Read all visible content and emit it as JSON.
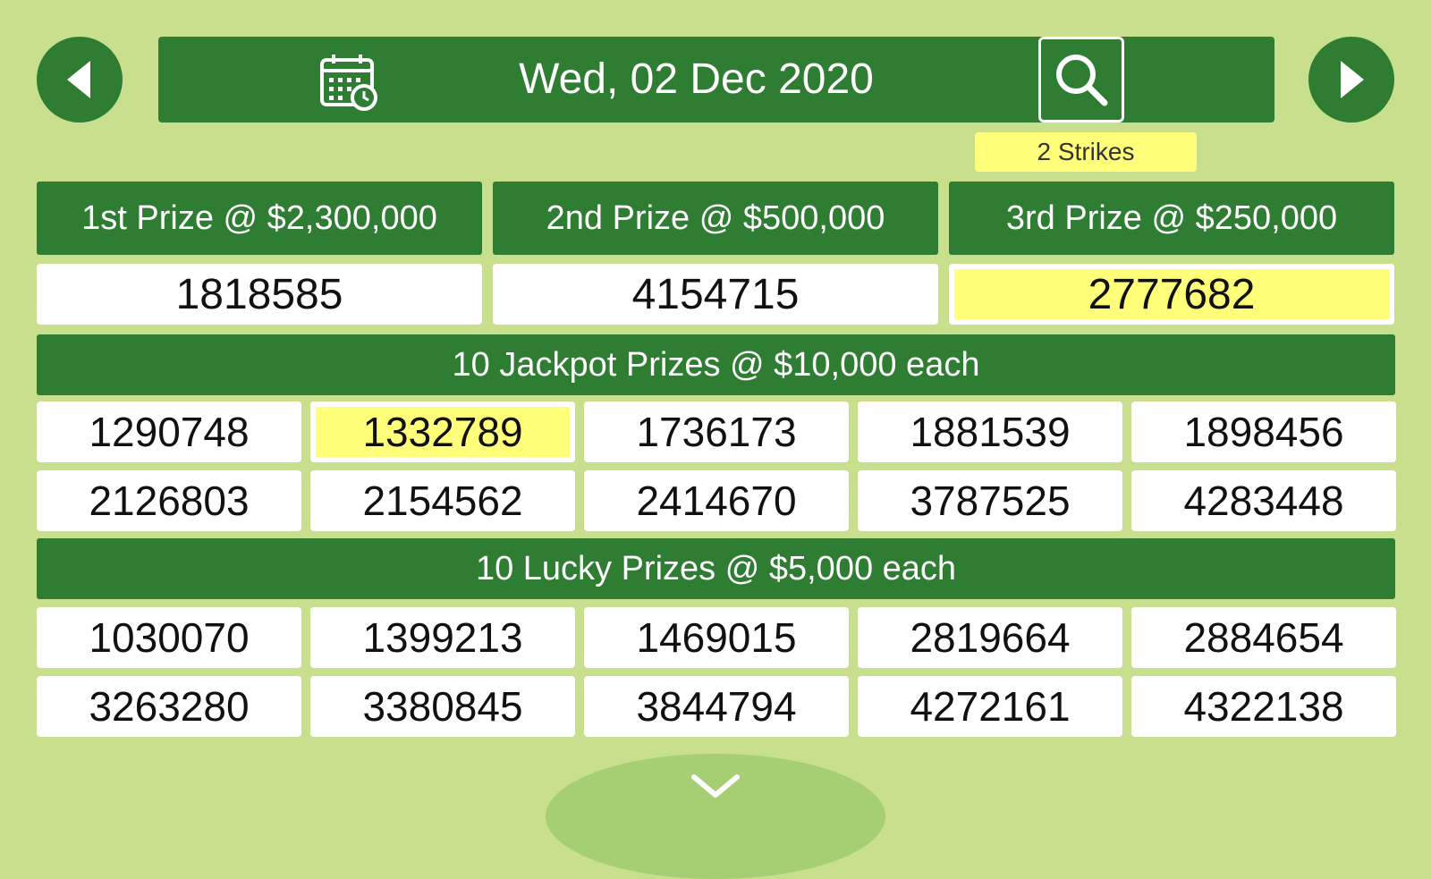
{
  "header": {
    "date": "Wed, 02 Dec 2020",
    "strikes_badge": "2 Strikes",
    "prev_icon": "triangle-left-icon",
    "next_icon": "triangle-right-icon",
    "calendar_icon": "calendar-clock-icon",
    "search_icon": "search-icon"
  },
  "top_prizes": [
    {
      "label": "1st Prize @ $2,300,000",
      "number": "1818585",
      "highlight": false
    },
    {
      "label": "2nd Prize @ $500,000",
      "number": "4154715",
      "highlight": false
    },
    {
      "label": "3rd Prize @ $250,000",
      "number": "2777682",
      "highlight": true
    }
  ],
  "jackpot": {
    "label": "10 Jackpot Prizes @ $10,000 each",
    "numbers": [
      "1290748",
      "1332789",
      "1736173",
      "1881539",
      "1898456",
      "2126803",
      "2154562",
      "2414670",
      "3787525",
      "4283448"
    ],
    "highlighted": [
      "1332789"
    ]
  },
  "lucky": {
    "label": "10 Lucky Prizes @ $5,000 each",
    "numbers": [
      "1030070",
      "1399213",
      "1469015",
      "2819664",
      "2884654",
      "3263280",
      "3380845",
      "3844794",
      "4272161",
      "4322138"
    ]
  },
  "footer": {
    "expand_icon": "chevron-down-icon"
  },
  "colors": {
    "background": "#c8df8e",
    "primary": "#2e7d32",
    "highlight": "#ffff7a"
  }
}
